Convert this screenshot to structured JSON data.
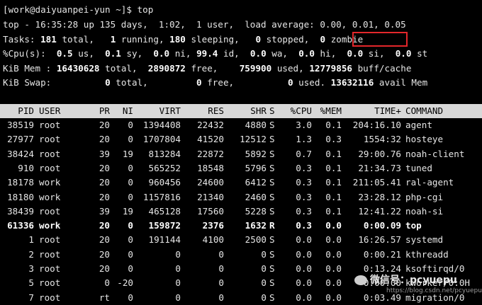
{
  "prompt": "[work@daiyuanpei-yun ~]$ top",
  "summary": {
    "uptime_line": "top - 16:35:28 up 135 days,  1:02,  1 user,  load average: 0.00, 0.01, 0.05",
    "tasks": {
      "label": "Tasks:",
      "total": "181",
      "total_lbl": "total,",
      "running": "1",
      "running_lbl": "running,",
      "sleeping": "180",
      "sleeping_lbl": "sleeping,",
      "stopped": "0",
      "stopped_lbl": "stopped,",
      "zombie": "0",
      "zombie_lbl": "zombie"
    },
    "cpu": {
      "label": "%Cpu(s):",
      "us": "0.5",
      "us_lbl": "us,",
      "sy": "0.1",
      "sy_lbl": "sy,",
      "ni": "0.0",
      "ni_lbl": "ni,",
      "id": "99.4",
      "id_lbl": "id,",
      "wa": "0.0",
      "wa_lbl": "wa,",
      "hi": "0.0",
      "hi_lbl": "hi,",
      "si": "0.0",
      "si_lbl": "si,",
      "st": "0.0",
      "st_lbl": "st"
    },
    "mem": {
      "label": "KiB Mem :",
      "total": "16430628",
      "total_lbl": "total,",
      "free": "2890872",
      "free_lbl": "free,",
      "used": "759900",
      "used_lbl": "used,",
      "buff": "12779856",
      "buff_lbl": "buff/cache"
    },
    "swap": {
      "label": "KiB Swap:",
      "total": "0",
      "total_lbl": "total,",
      "free": "0",
      "free_lbl": "free,",
      "used": "0",
      "used_lbl": "used.",
      "avail": "13632116",
      "avail_lbl": "avail Mem"
    }
  },
  "columns": [
    "PID",
    "USER",
    "PR",
    "NI",
    "VIRT",
    "RES",
    "SHR",
    "S",
    "%CPU",
    "%MEM",
    "TIME+",
    "COMMAND"
  ],
  "processes": [
    [
      "38519",
      "root",
      "20",
      "0",
      "1394408",
      "22432",
      "4880",
      "S",
      "3.0",
      "0.1",
      "204:16.10",
      "agent"
    ],
    [
      "27977",
      "root",
      "20",
      "0",
      "1707804",
      "41520",
      "12512",
      "S",
      "1.3",
      "0.3",
      "1554:32",
      "hosteye"
    ],
    [
      "38424",
      "root",
      "39",
      "19",
      "813284",
      "22872",
      "5892",
      "S",
      "0.7",
      "0.1",
      "29:00.76",
      "noah-client"
    ],
    [
      "910",
      "root",
      "20",
      "0",
      "565252",
      "18548",
      "5796",
      "S",
      "0.3",
      "0.1",
      "21:34.73",
      "tuned"
    ],
    [
      "18178",
      "work",
      "20",
      "0",
      "960456",
      "24600",
      "6412",
      "S",
      "0.3",
      "0.1",
      "211:05.41",
      "ral-agent"
    ],
    [
      "18180",
      "work",
      "20",
      "0",
      "1157816",
      "21340",
      "2460",
      "S",
      "0.3",
      "0.1",
      "23:28.12",
      "php-cgi"
    ],
    [
      "38439",
      "root",
      "39",
      "19",
      "465128",
      "17560",
      "5228",
      "S",
      "0.3",
      "0.1",
      "12:41.22",
      "noah-si"
    ],
    [
      "61336",
      "work",
      "20",
      "0",
      "159872",
      "2376",
      "1632",
      "R",
      "0.3",
      "0.0",
      "0:00.09",
      "top"
    ],
    [
      "1",
      "root",
      "20",
      "0",
      "191144",
      "4100",
      "2500",
      "S",
      "0.0",
      "0.0",
      "16:26.57",
      "systemd"
    ],
    [
      "2",
      "root",
      "20",
      "0",
      "0",
      "0",
      "0",
      "S",
      "0.0",
      "0.0",
      "0:00.21",
      "kthreadd"
    ],
    [
      "3",
      "root",
      "20",
      "0",
      "0",
      "0",
      "0",
      "S",
      "0.0",
      "0.0",
      "0:13.24",
      "ksoftirqd/0"
    ],
    [
      "5",
      "root",
      "0",
      "-20",
      "0",
      "0",
      "0",
      "S",
      "0.0",
      "0.0",
      "0:00.00",
      "kworker/0:0H"
    ],
    [
      "7",
      "root",
      "rt",
      "0",
      "0",
      "0",
      "0",
      "S",
      "0.0",
      "0.0",
      "0:03.49",
      "migration/0"
    ]
  ],
  "highlight_row_index": 7,
  "watermark": {
    "title": "微信号：pcyuepu",
    "subtitle": "https://blog.csdn.net/pcyuepu"
  },
  "colors": {
    "background": "#000000",
    "foreground": "#e6e6e6",
    "header_bar": "#d8d8d8",
    "highlight_box": "#e3272b"
  }
}
